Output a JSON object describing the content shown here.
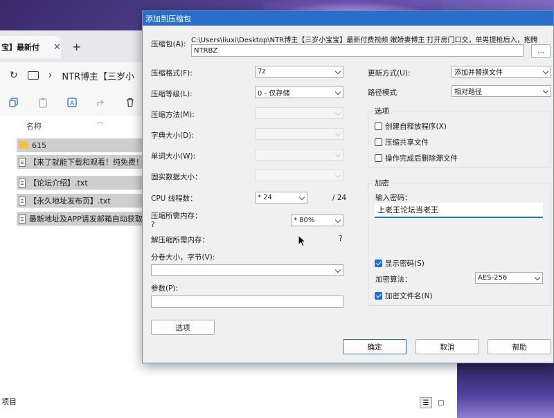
{
  "explorer": {
    "tab_title": "宝】最新付",
    "tab_close": "✕",
    "new_tab": "+",
    "breadcrumb": "NTR博主【三岁小",
    "column_name": "名称",
    "files": [
      {
        "name": "615",
        "type": "folder"
      },
      {
        "name": "【来了就能下载和观看！纯免费！",
        "type": "file"
      },
      {
        "name": "【论坛介绍】.txt",
        "type": "file"
      },
      {
        "name": "【永久地址发布页】.txt",
        "type": "file"
      },
      {
        "name": "最新地址及APP请发邮箱自动获取",
        "type": "file"
      }
    ],
    "status": "项目"
  },
  "dialog": {
    "title": "添加到压缩包",
    "archive_label": "压缩包(A):",
    "archive_path": "C:\\Users\\liuxi\\Desktop\\NTR博主【三岁小宝宝】最新付费视频 嫩娇妻博主 打开房门口交，单男提枪后入，抱腾",
    "archive_name": "NTRBZ",
    "browse_label": "...",
    "format_label": "压缩格式(F):",
    "format_value": "7z",
    "level_label": "压缩等级(L):",
    "level_value": "0 - 仅存储",
    "method_label": "压缩方法(M):",
    "dict_label": "字典大小(D):",
    "word_label": "单词大小(W):",
    "solid_label": "固实数据大小：",
    "threads_label": "CPU 线程数：",
    "threads_value": "* 24",
    "threads_max": "/ 24",
    "mem_comp_label": "压缩所需内存：",
    "mem_comp_value": "?",
    "mem_percent_value": "* 80%",
    "mem_decomp_label": "解压缩所需内存：",
    "mem_decomp_value": "?",
    "volume_label": "分卷大小，字节(V):",
    "params_label": "参数(P):",
    "options_button": "选项",
    "update_label": "更新方式(U):",
    "update_value": "添加并替换文件",
    "path_label": "路径模式",
    "path_value": "相对路径",
    "options_group": "选项",
    "opt_sfx": "创建自释放程序(X)",
    "opt_shared": "压缩共享文件",
    "opt_delete": "操作完成后删除源文件",
    "encrypt_group": "加密",
    "pwd_label": "输入密码：",
    "pwd_value": "上老王论坛当老王",
    "show_pwd": "显示密码(S)",
    "enc_method_label": "加密算法：",
    "enc_method_value": "AES-256",
    "enc_names": "加密文件名(N)",
    "ok_button": "确定",
    "cancel_button": "取消",
    "help_button": "帮助"
  }
}
